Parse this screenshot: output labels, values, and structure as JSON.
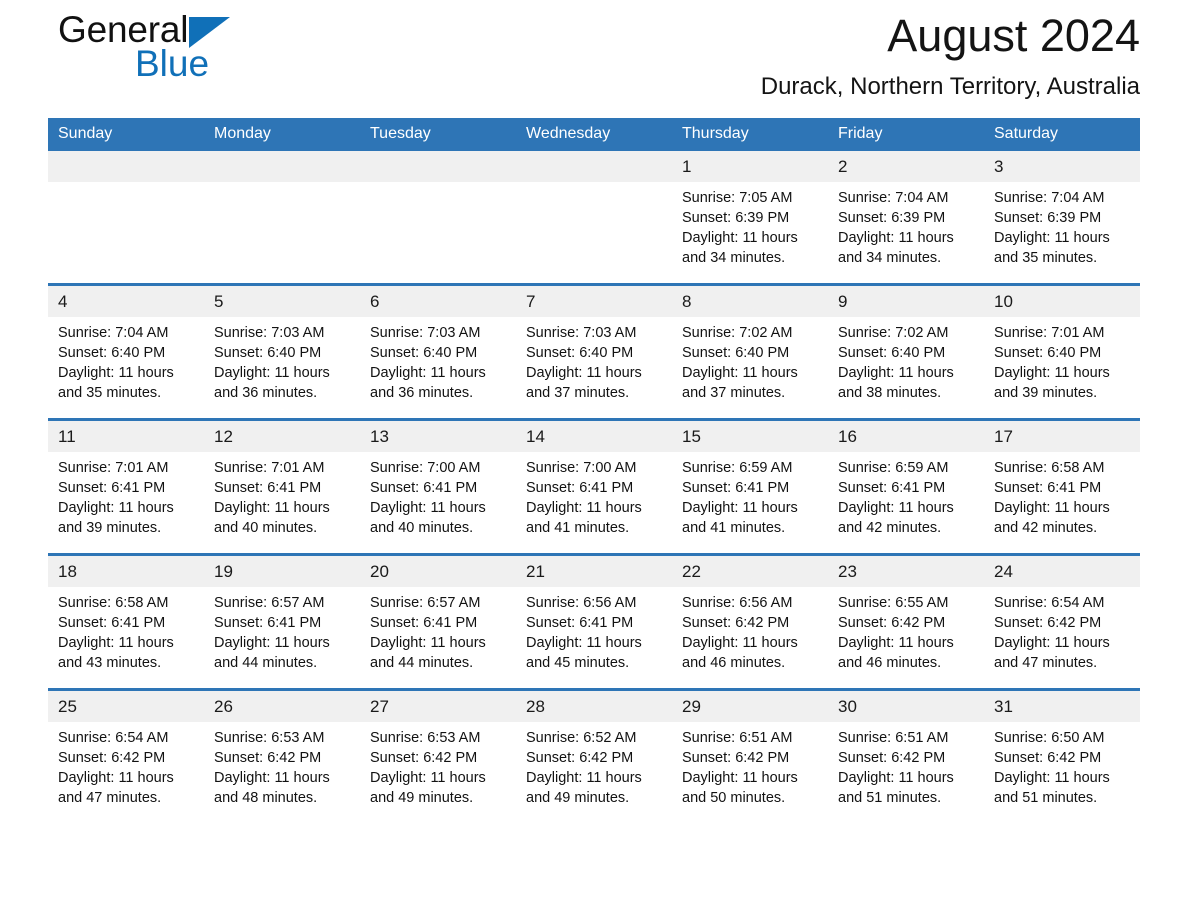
{
  "brand": {
    "name_part1": "General",
    "name_part2": "Blue",
    "accent_color": "#1070b8",
    "logo_icon": "triangle-icon"
  },
  "header": {
    "title": "August 2024",
    "subtitle": "Durack, Northern Territory, Australia"
  },
  "calendar": {
    "header_bg": "#2e75b6",
    "daynum_bg": "#f0f0f0",
    "weekday_headers": [
      "Sunday",
      "Monday",
      "Tuesday",
      "Wednesday",
      "Thursday",
      "Friday",
      "Saturday"
    ],
    "weeks": [
      [
        {
          "day": "",
          "sunrise": "",
          "sunset": "",
          "daylight_line1": "",
          "daylight_line2": ""
        },
        {
          "day": "",
          "sunrise": "",
          "sunset": "",
          "daylight_line1": "",
          "daylight_line2": ""
        },
        {
          "day": "",
          "sunrise": "",
          "sunset": "",
          "daylight_line1": "",
          "daylight_line2": ""
        },
        {
          "day": "",
          "sunrise": "",
          "sunset": "",
          "daylight_line1": "",
          "daylight_line2": ""
        },
        {
          "day": "1",
          "sunrise": "Sunrise: 7:05 AM",
          "sunset": "Sunset: 6:39 PM",
          "daylight_line1": "Daylight: 11 hours",
          "daylight_line2": "and 34 minutes."
        },
        {
          "day": "2",
          "sunrise": "Sunrise: 7:04 AM",
          "sunset": "Sunset: 6:39 PM",
          "daylight_line1": "Daylight: 11 hours",
          "daylight_line2": "and 34 minutes."
        },
        {
          "day": "3",
          "sunrise": "Sunrise: 7:04 AM",
          "sunset": "Sunset: 6:39 PM",
          "daylight_line1": "Daylight: 11 hours",
          "daylight_line2": "and 35 minutes."
        }
      ],
      [
        {
          "day": "4",
          "sunrise": "Sunrise: 7:04 AM",
          "sunset": "Sunset: 6:40 PM",
          "daylight_line1": "Daylight: 11 hours",
          "daylight_line2": "and 35 minutes."
        },
        {
          "day": "5",
          "sunrise": "Sunrise: 7:03 AM",
          "sunset": "Sunset: 6:40 PM",
          "daylight_line1": "Daylight: 11 hours",
          "daylight_line2": "and 36 minutes."
        },
        {
          "day": "6",
          "sunrise": "Sunrise: 7:03 AM",
          "sunset": "Sunset: 6:40 PM",
          "daylight_line1": "Daylight: 11 hours",
          "daylight_line2": "and 36 minutes."
        },
        {
          "day": "7",
          "sunrise": "Sunrise: 7:03 AM",
          "sunset": "Sunset: 6:40 PM",
          "daylight_line1": "Daylight: 11 hours",
          "daylight_line2": "and 37 minutes."
        },
        {
          "day": "8",
          "sunrise": "Sunrise: 7:02 AM",
          "sunset": "Sunset: 6:40 PM",
          "daylight_line1": "Daylight: 11 hours",
          "daylight_line2": "and 37 minutes."
        },
        {
          "day": "9",
          "sunrise": "Sunrise: 7:02 AM",
          "sunset": "Sunset: 6:40 PM",
          "daylight_line1": "Daylight: 11 hours",
          "daylight_line2": "and 38 minutes."
        },
        {
          "day": "10",
          "sunrise": "Sunrise: 7:01 AM",
          "sunset": "Sunset: 6:40 PM",
          "daylight_line1": "Daylight: 11 hours",
          "daylight_line2": "and 39 minutes."
        }
      ],
      [
        {
          "day": "11",
          "sunrise": "Sunrise: 7:01 AM",
          "sunset": "Sunset: 6:41 PM",
          "daylight_line1": "Daylight: 11 hours",
          "daylight_line2": "and 39 minutes."
        },
        {
          "day": "12",
          "sunrise": "Sunrise: 7:01 AM",
          "sunset": "Sunset: 6:41 PM",
          "daylight_line1": "Daylight: 11 hours",
          "daylight_line2": "and 40 minutes."
        },
        {
          "day": "13",
          "sunrise": "Sunrise: 7:00 AM",
          "sunset": "Sunset: 6:41 PM",
          "daylight_line1": "Daylight: 11 hours",
          "daylight_line2": "and 40 minutes."
        },
        {
          "day": "14",
          "sunrise": "Sunrise: 7:00 AM",
          "sunset": "Sunset: 6:41 PM",
          "daylight_line1": "Daylight: 11 hours",
          "daylight_line2": "and 41 minutes."
        },
        {
          "day": "15",
          "sunrise": "Sunrise: 6:59 AM",
          "sunset": "Sunset: 6:41 PM",
          "daylight_line1": "Daylight: 11 hours",
          "daylight_line2": "and 41 minutes."
        },
        {
          "day": "16",
          "sunrise": "Sunrise: 6:59 AM",
          "sunset": "Sunset: 6:41 PM",
          "daylight_line1": "Daylight: 11 hours",
          "daylight_line2": "and 42 minutes."
        },
        {
          "day": "17",
          "sunrise": "Sunrise: 6:58 AM",
          "sunset": "Sunset: 6:41 PM",
          "daylight_line1": "Daylight: 11 hours",
          "daylight_line2": "and 42 minutes."
        }
      ],
      [
        {
          "day": "18",
          "sunrise": "Sunrise: 6:58 AM",
          "sunset": "Sunset: 6:41 PM",
          "daylight_line1": "Daylight: 11 hours",
          "daylight_line2": "and 43 minutes."
        },
        {
          "day": "19",
          "sunrise": "Sunrise: 6:57 AM",
          "sunset": "Sunset: 6:41 PM",
          "daylight_line1": "Daylight: 11 hours",
          "daylight_line2": "and 44 minutes."
        },
        {
          "day": "20",
          "sunrise": "Sunrise: 6:57 AM",
          "sunset": "Sunset: 6:41 PM",
          "daylight_line1": "Daylight: 11 hours",
          "daylight_line2": "and 44 minutes."
        },
        {
          "day": "21",
          "sunrise": "Sunrise: 6:56 AM",
          "sunset": "Sunset: 6:41 PM",
          "daylight_line1": "Daylight: 11 hours",
          "daylight_line2": "and 45 minutes."
        },
        {
          "day": "22",
          "sunrise": "Sunrise: 6:56 AM",
          "sunset": "Sunset: 6:42 PM",
          "daylight_line1": "Daylight: 11 hours",
          "daylight_line2": "and 46 minutes."
        },
        {
          "day": "23",
          "sunrise": "Sunrise: 6:55 AM",
          "sunset": "Sunset: 6:42 PM",
          "daylight_line1": "Daylight: 11 hours",
          "daylight_line2": "and 46 minutes."
        },
        {
          "day": "24",
          "sunrise": "Sunrise: 6:54 AM",
          "sunset": "Sunset: 6:42 PM",
          "daylight_line1": "Daylight: 11 hours",
          "daylight_line2": "and 47 minutes."
        }
      ],
      [
        {
          "day": "25",
          "sunrise": "Sunrise: 6:54 AM",
          "sunset": "Sunset: 6:42 PM",
          "daylight_line1": "Daylight: 11 hours",
          "daylight_line2": "and 47 minutes."
        },
        {
          "day": "26",
          "sunrise": "Sunrise: 6:53 AM",
          "sunset": "Sunset: 6:42 PM",
          "daylight_line1": "Daylight: 11 hours",
          "daylight_line2": "and 48 minutes."
        },
        {
          "day": "27",
          "sunrise": "Sunrise: 6:53 AM",
          "sunset": "Sunset: 6:42 PM",
          "daylight_line1": "Daylight: 11 hours",
          "daylight_line2": "and 49 minutes."
        },
        {
          "day": "28",
          "sunrise": "Sunrise: 6:52 AM",
          "sunset": "Sunset: 6:42 PM",
          "daylight_line1": "Daylight: 11 hours",
          "daylight_line2": "and 49 minutes."
        },
        {
          "day": "29",
          "sunrise": "Sunrise: 6:51 AM",
          "sunset": "Sunset: 6:42 PM",
          "daylight_line1": "Daylight: 11 hours",
          "daylight_line2": "and 50 minutes."
        },
        {
          "day": "30",
          "sunrise": "Sunrise: 6:51 AM",
          "sunset": "Sunset: 6:42 PM",
          "daylight_line1": "Daylight: 11 hours",
          "daylight_line2": "and 51 minutes."
        },
        {
          "day": "31",
          "sunrise": "Sunrise: 6:50 AM",
          "sunset": "Sunset: 6:42 PM",
          "daylight_line1": "Daylight: 11 hours",
          "daylight_line2": "and 51 minutes."
        }
      ]
    ]
  }
}
